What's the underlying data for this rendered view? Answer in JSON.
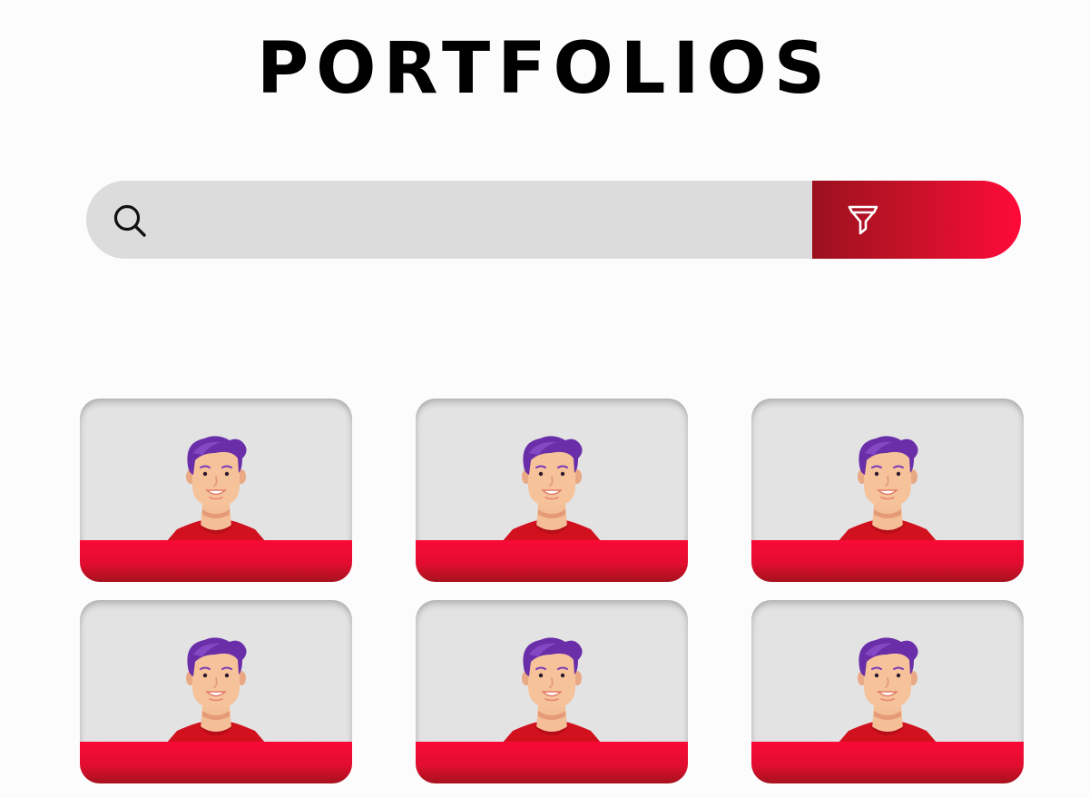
{
  "page": {
    "title": "PORTFOLIOS"
  },
  "search": {
    "value": "",
    "placeholder": "",
    "icon": "search-icon"
  },
  "filter": {
    "icon": "filter-icon"
  },
  "colors": {
    "background": "#fcfcfd",
    "search_bg": "#dcdcdc",
    "accent_dark": "#9b111e",
    "accent_bright": "#ff0a3a",
    "card_bg": "#e3e3e4",
    "hair": "#6a2fa8",
    "skin": "#f4bf97",
    "shirt": "#d2111f"
  },
  "portfolios": [
    {
      "avatar": "person-avatar"
    },
    {
      "avatar": "person-avatar"
    },
    {
      "avatar": "person-avatar"
    },
    {
      "avatar": "person-avatar"
    },
    {
      "avatar": "person-avatar"
    },
    {
      "avatar": "person-avatar"
    }
  ]
}
